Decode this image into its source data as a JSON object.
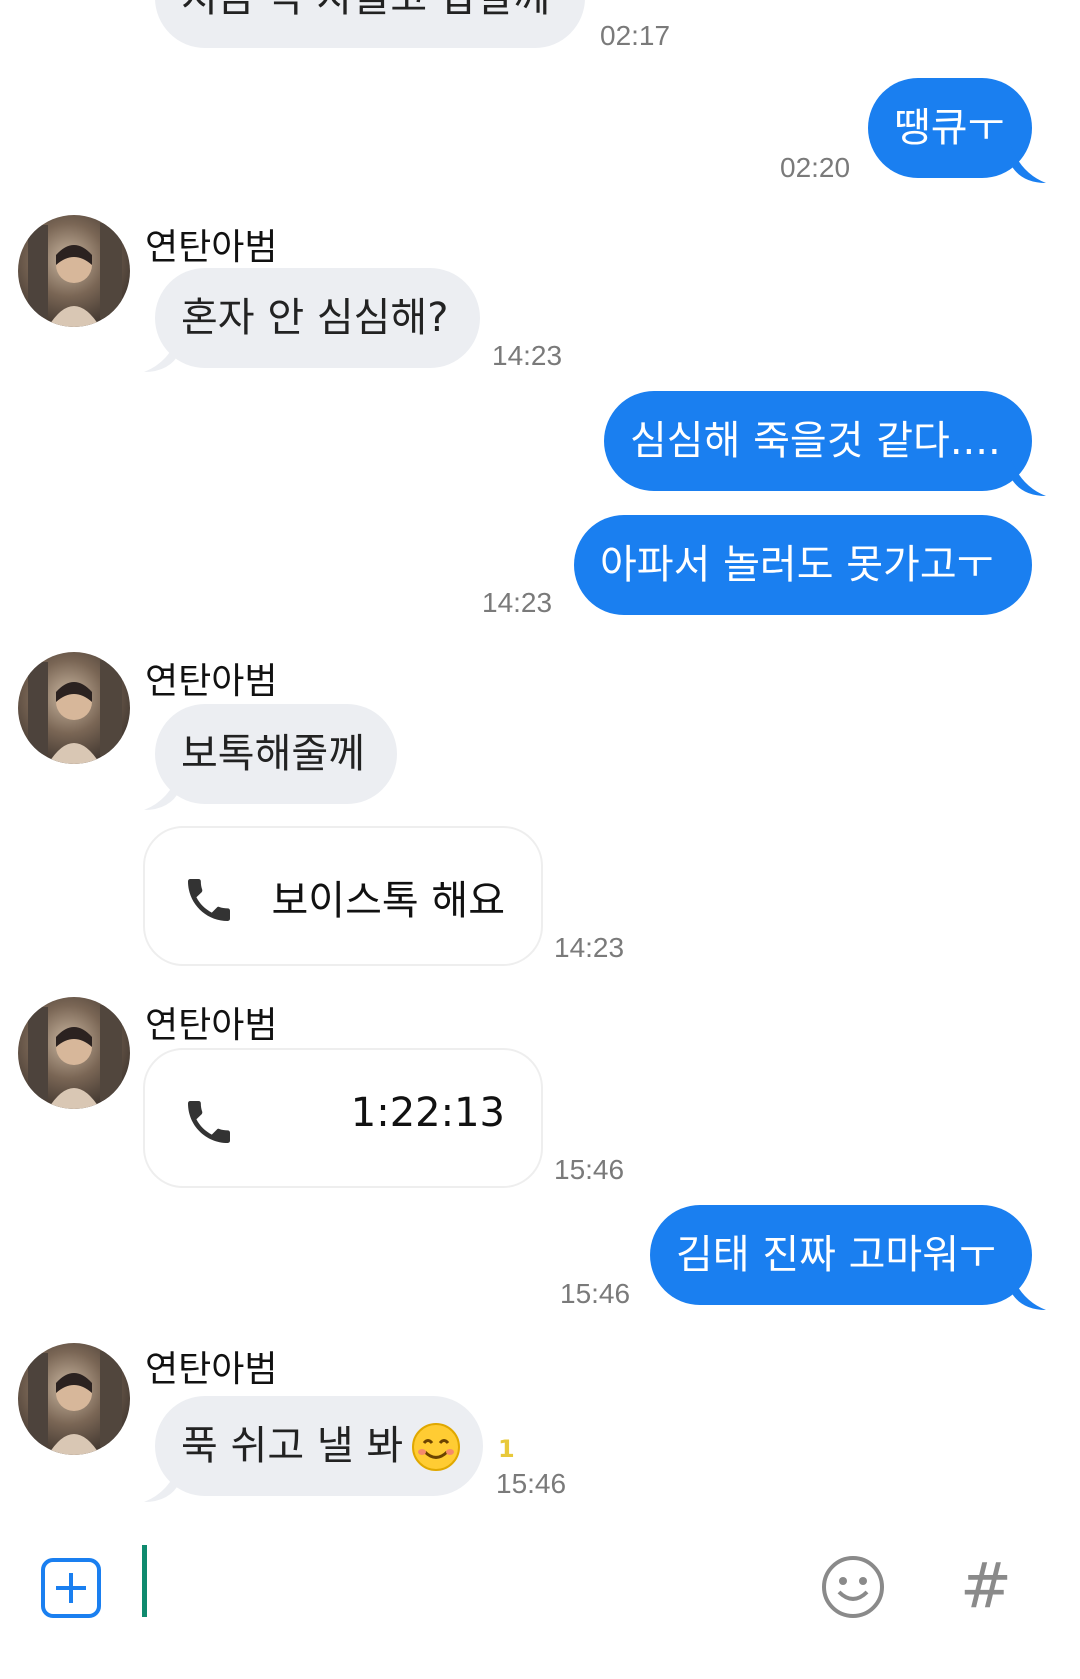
{
  "messages": [
    {
      "id": "m0",
      "text": "지금 막 자올고 갑갈께",
      "time": "02:17"
    },
    {
      "id": "m1",
      "text": "땡큐ㅜ",
      "time": "02:20"
    },
    {
      "id": "m2",
      "sender": "연탄아범",
      "text": "혼자 안 심심해?",
      "time": "14:23"
    },
    {
      "id": "m3",
      "text": "심심해 죽을것 같다...."
    },
    {
      "id": "m4",
      "text": "아파서 놀러도 못가고ㅜ",
      "time": "14:23"
    },
    {
      "id": "m5",
      "sender": "연탄아범",
      "text": "보톡해줄께"
    },
    {
      "id": "m6",
      "call_label": "보이스톡 해요",
      "time": "14:23"
    },
    {
      "id": "m7",
      "sender": "연탄아범",
      "call_label": "1:22:13",
      "time": "15:46"
    },
    {
      "id": "m8",
      "text": "김태 진짜 고마워ㅜ",
      "time": "15:46"
    },
    {
      "id": "m9",
      "sender": "연탄아범",
      "text": "푹 쉬고 낼 봐",
      "unread": "1",
      "time": "15:46"
    }
  ],
  "icons": {
    "phone": "phone-icon",
    "smile_emoji": "smiling-face-icon",
    "add": "plus-square-icon",
    "emoji": "emoji-icon",
    "hashtag": "hashtag-icon"
  },
  "input": {
    "hashtag_label": "#"
  },
  "colors": {
    "outgoing": "#1a7ff0",
    "incoming": "#eceef2",
    "cursor": "#0f8a6e",
    "accent": "#1a7ff0"
  }
}
